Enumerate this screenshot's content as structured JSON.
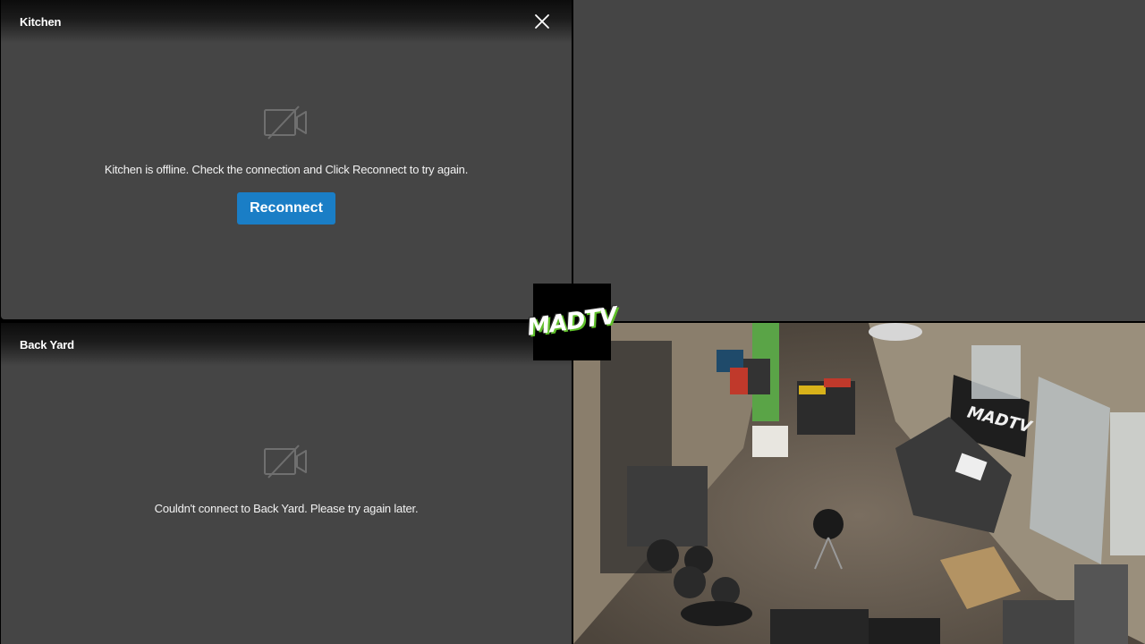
{
  "tiles": {
    "kitchen": {
      "title": "Kitchen",
      "message": "Kitchen is offline. Check the connection and Click Reconnect to try again.",
      "reconnect_label": "Reconnect"
    },
    "backyard": {
      "title": "Back Yard",
      "message": "Couldn't connect to Back Yard. Please try again later."
    },
    "live_feed": {
      "logo_text": "MADTV"
    }
  },
  "overlay_logo": {
    "text": "MADTV"
  },
  "colors": {
    "tile_bg": "#454545",
    "button_blue": "#1a7ec6",
    "logo_green": "#5fbf2a"
  },
  "icons": {
    "close": "close-icon",
    "offline": "camera-off-icon"
  }
}
